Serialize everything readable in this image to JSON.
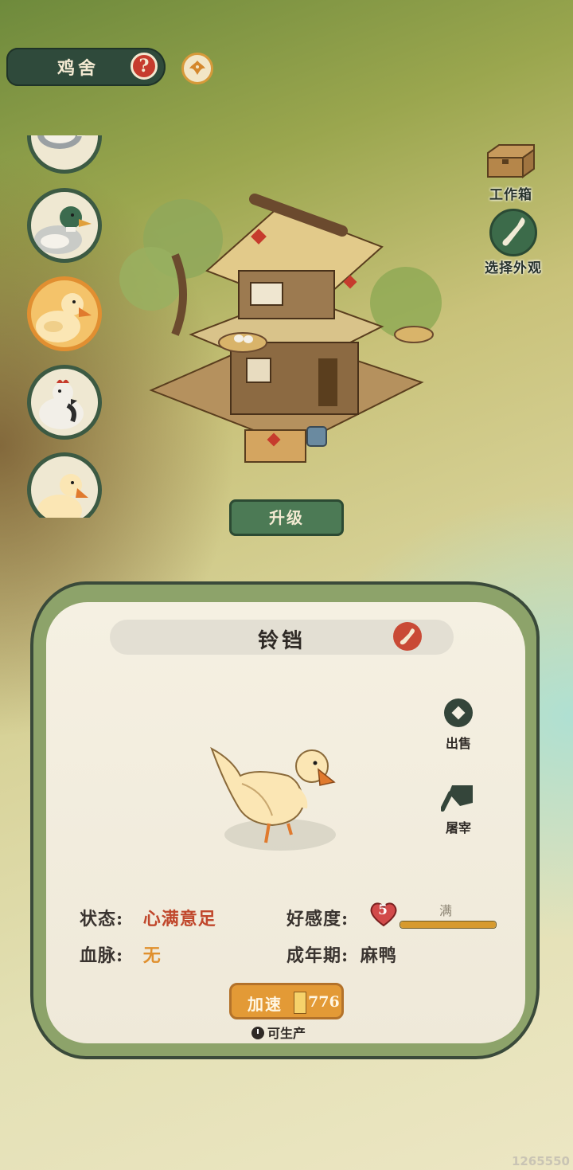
{
  "header": {
    "title": "鸡舍",
    "help_icon": "question-mark-icon",
    "phoenix_icon": "phoenix-emblem-icon"
  },
  "animals": [
    {
      "id": "goose",
      "icon": "goose-icon"
    },
    {
      "id": "mallard",
      "icon": "mallard-duck-icon"
    },
    {
      "id": "duck-yellow-selected",
      "icon": "yellow-duck-icon"
    },
    {
      "id": "chicken",
      "icon": "chicken-icon"
    },
    {
      "id": "duck-yellow",
      "icon": "yellow-duck-icon"
    }
  ],
  "side_buttons": {
    "workbox_label": "工作箱",
    "appearance_label": "选择外观"
  },
  "building": {
    "upgrade_label": "升级"
  },
  "panel": {
    "name": "铃铛",
    "sell_label": "出售",
    "slaughter_label": "屠宰",
    "stats": {
      "status_label": "状态:",
      "status_value": "心满意足",
      "bloodline_label": "血脉:",
      "bloodline_value": "无",
      "affection_label": "好感度:",
      "affection_level": "5",
      "affection_bar_label": "满",
      "affection_fill": 1.0,
      "adult_label": "成年期:",
      "adult_value": "麻鸭"
    },
    "speedup": {
      "label": "加速",
      "cost": "776"
    },
    "production_status": "可生产"
  },
  "watermark": "1265550",
  "colors": {
    "accent_green": "#4c7a55",
    "accent_orange": "#e39a36",
    "status_red": "#c0472c",
    "dark_pill": "#2f4a3b"
  }
}
